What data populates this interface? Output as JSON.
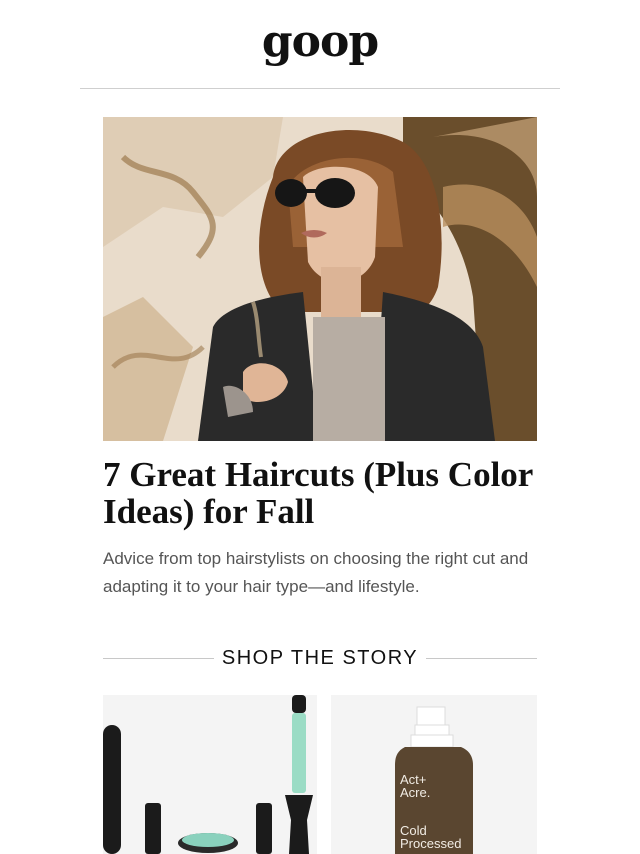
{
  "brand": {
    "logo_text": "goop"
  },
  "article": {
    "headline": "7 Great Haircuts (Plus Color Ideas) for Fall",
    "dek": "Advice from top hairstylists on choosing the right cut and adapting it to your hair type—and lifestyle."
  },
  "shop": {
    "title": "SHOP THE STORY",
    "products": [
      {
        "icon": "hair-tools-image"
      },
      {
        "icon": "bottle-image",
        "bottle_brand": "Act+\nAcre.",
        "bottle_line1": "Cold",
        "bottle_line2": "Processed"
      }
    ]
  }
}
